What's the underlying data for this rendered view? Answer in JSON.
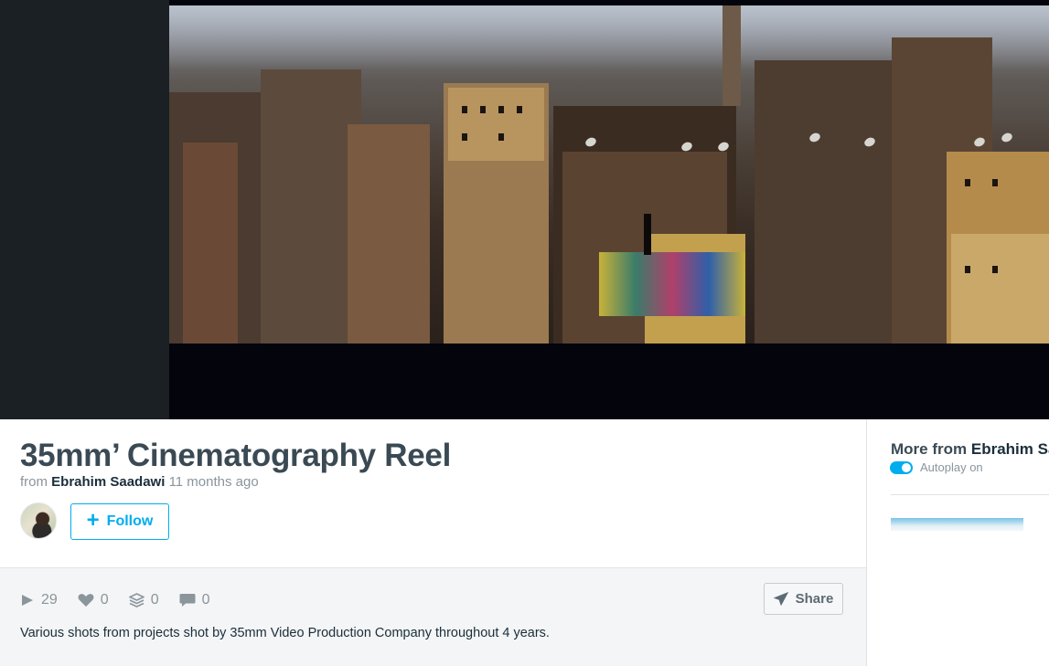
{
  "video": {
    "description": "",
    "colors": {
      "frame_bg": "#03040c",
      "side_bg": "#1a2024"
    }
  },
  "clip": {
    "title": "35mm’ Cinematography Reel",
    "from_label": "from",
    "author": "Ebrahim Saadawi",
    "posted": "11 months ago",
    "follow_label": "Follow",
    "description": "Various shots from projects shot by 35mm Video Production Company throughout 4 years."
  },
  "stats": {
    "plays": "29",
    "likes": "0",
    "collections": "0",
    "comments": "0",
    "share_label": "Share"
  },
  "sidebar": {
    "more_from_label": "More from",
    "more_from_name": "Ebrahim Saadawi",
    "autoplay_label": "Autoplay on",
    "autoplay_on": true
  },
  "colors": {
    "accent": "#00adef",
    "title": "#3a4a54",
    "muted": "#8a959c"
  }
}
